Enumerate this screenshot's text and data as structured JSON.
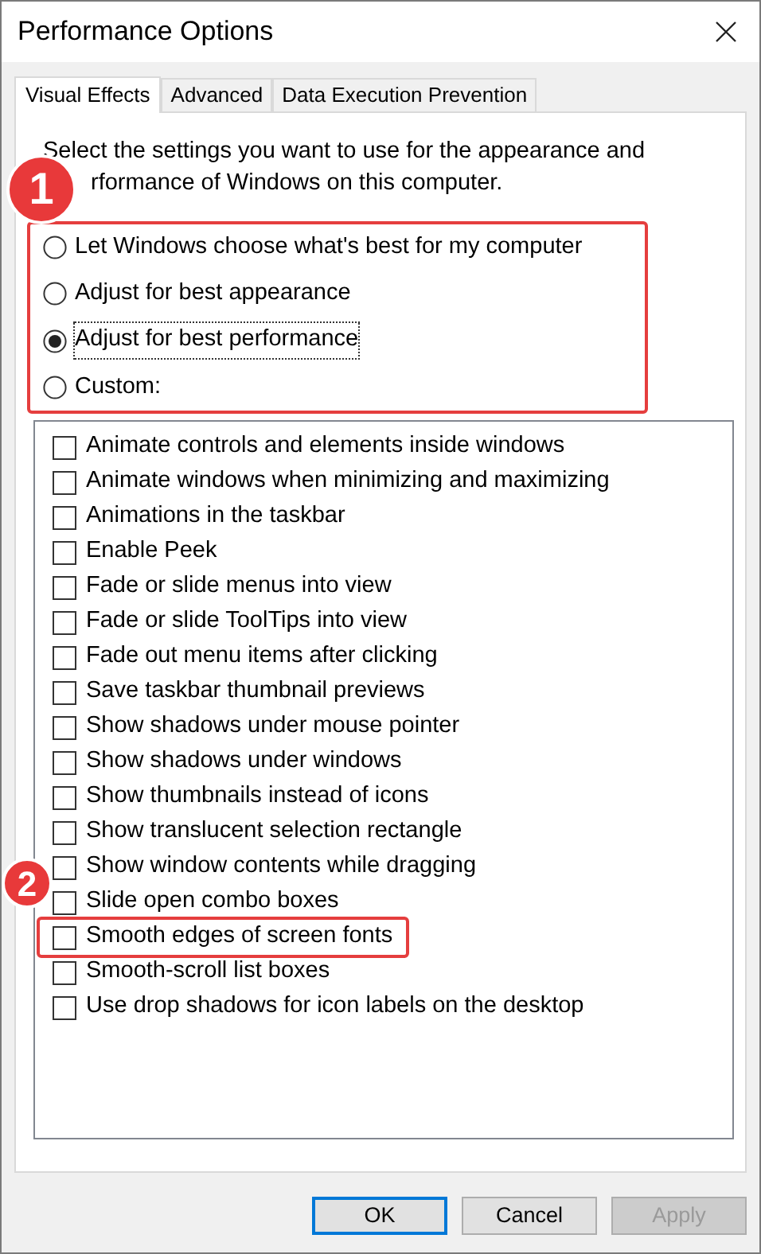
{
  "window": {
    "title": "Performance Options"
  },
  "tabs": [
    {
      "label": "Visual Effects",
      "selected": true
    },
    {
      "label": "Advanced",
      "selected": false
    },
    {
      "label": "Data Execution Prevention",
      "selected": false
    }
  ],
  "description": [
    "Select the settings you want to use for the appearance and",
    "rformance of Windows on this computer."
  ],
  "settings": {
    "highlighted": true,
    "options": [
      {
        "label": "Let Windows choose what's best for my computer",
        "selected": false
      },
      {
        "label": "Adjust for best appearance",
        "selected": false
      },
      {
        "label": "Adjust for best performance",
        "selected": true
      },
      {
        "label": "Custom:",
        "selected": false
      }
    ]
  },
  "effects": [
    {
      "label": "Animate controls and elements inside windows",
      "checked": false,
      "highlighted": false
    },
    {
      "label": "Animate windows when minimizing and maximizing",
      "checked": false,
      "highlighted": false
    },
    {
      "label": "Animations in the taskbar",
      "checked": false,
      "highlighted": false
    },
    {
      "label": "Enable Peek",
      "checked": false,
      "highlighted": false
    },
    {
      "label": "Fade or slide menus into view",
      "checked": false,
      "highlighted": false
    },
    {
      "label": "Fade or slide ToolTips into view",
      "checked": false,
      "highlighted": false
    },
    {
      "label": "Fade out menu items after clicking",
      "checked": false,
      "highlighted": false
    },
    {
      "label": "Save taskbar thumbnail previews",
      "checked": false,
      "highlighted": false
    },
    {
      "label": "Show shadows under mouse pointer",
      "checked": false,
      "highlighted": false
    },
    {
      "label": "Show shadows under windows",
      "checked": false,
      "highlighted": false
    },
    {
      "label": "Show thumbnails instead of icons",
      "checked": false,
      "highlighted": false
    },
    {
      "label": "Show translucent selection rectangle",
      "checked": false,
      "highlighted": false
    },
    {
      "label": "Show window contents while dragging",
      "checked": false,
      "highlighted": false
    },
    {
      "label": "Slide open combo boxes",
      "checked": false,
      "highlighted": false
    },
    {
      "label": "Smooth edges of screen fonts",
      "checked": false,
      "highlighted": true
    },
    {
      "label": "Smooth-scroll list boxes",
      "checked": false,
      "highlighted": false
    },
    {
      "label": "Use drop shadows for icon labels on the desktop",
      "checked": false,
      "highlighted": false
    }
  ],
  "annotations": [
    {
      "label": "1"
    },
    {
      "label": "2"
    }
  ],
  "buttons": [
    {
      "label": "OK",
      "disabled": false,
      "focused": true
    },
    {
      "label": "Cancel",
      "disabled": false,
      "focused": false
    },
    {
      "label": "Apply",
      "disabled": true,
      "focused": false
    }
  ]
}
